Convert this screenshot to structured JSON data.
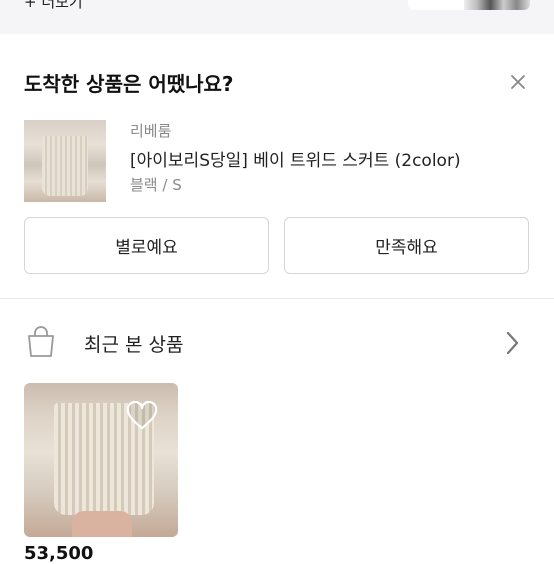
{
  "top": {
    "more_label": "+ 더보기"
  },
  "review_card": {
    "title": "도착한 상품은 어땠나요?",
    "product": {
      "brand": "리베룸",
      "name": "[아이보리S당일] 베이 트위드 스커트 (2color)",
      "option": "블랙 / S"
    },
    "buttons": {
      "bad_label": "별로예요",
      "good_label": "만족해요"
    }
  },
  "recent": {
    "title": "최근 본 상품",
    "items": [
      {
        "price": "53,500"
      }
    ]
  },
  "icons": {
    "close": "close-icon",
    "bag": "shopping-bag-icon",
    "chevron": "chevron-right-icon",
    "heart": "heart-icon"
  },
  "colors": {
    "text": "#111111",
    "subtext": "#8a8a8a",
    "border": "#d6d6d6",
    "top_strip_bg": "#f5f5f7"
  }
}
